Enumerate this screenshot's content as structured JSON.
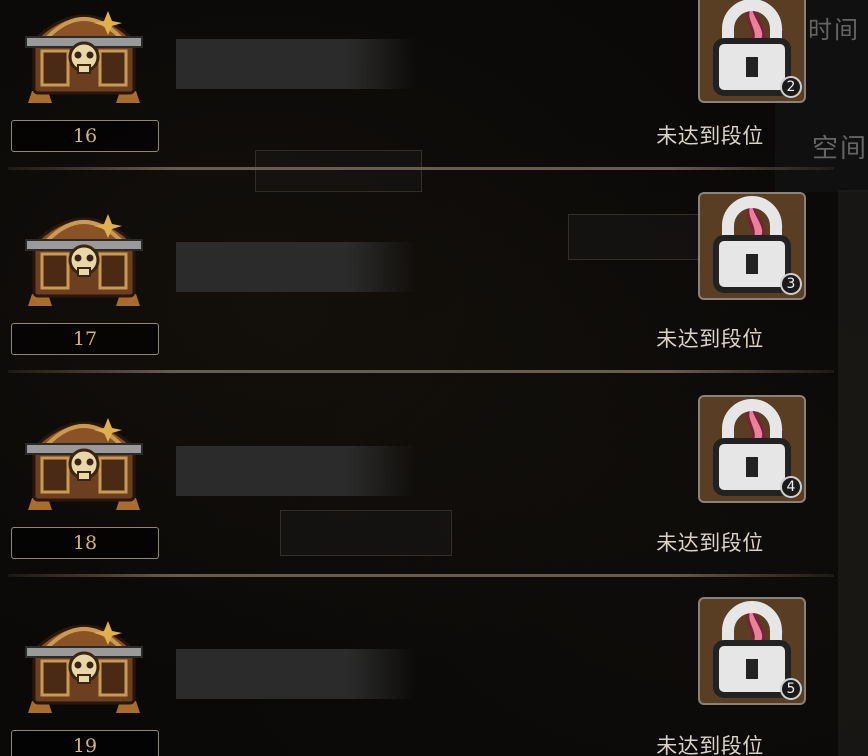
{
  "background": {
    "right_label_time": "时间",
    "right_label_space": "空间"
  },
  "tiers": [
    {
      "level": "16",
      "reward_count": "2",
      "status": "未达到段位"
    },
    {
      "level": "17",
      "reward_count": "3",
      "status": "未达到段位"
    },
    {
      "level": "18",
      "reward_count": "4",
      "status": "未达到段位"
    },
    {
      "level": "19",
      "reward_count": "5",
      "status": "未达到段位"
    }
  ],
  "icons": {
    "chest": "treasure-chest-icon",
    "reward": "flame-icon",
    "lock": "lock-icon"
  },
  "colors": {
    "level_text": "#d6b472",
    "status_text": "#d9d2c6",
    "card_bg": "#5a3e24",
    "flame": "#e8829a"
  }
}
